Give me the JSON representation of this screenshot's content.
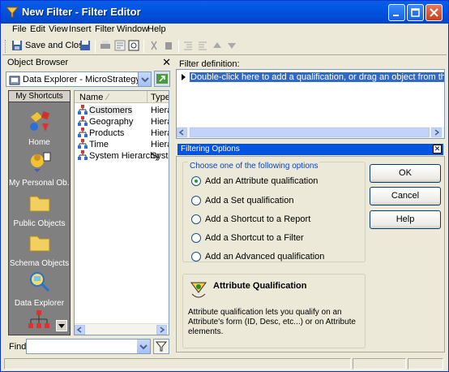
{
  "window": {
    "title": "New Filter - Filter Editor"
  },
  "menu": [
    "File",
    "Edit",
    "View",
    "Insert",
    "Filter",
    "Window",
    "Help"
  ],
  "toolbar": {
    "save_close_label": "Save and Close"
  },
  "object_browser": {
    "title": "Object Browser",
    "project": "Data Explorer - MicroStrategy Tutorial",
    "shortcuts_header": "My Shortcuts",
    "shortcuts": [
      {
        "label": "Home",
        "icon": "home-icon"
      },
      {
        "label": "My Personal Ob...",
        "icon": "personal-objects-icon"
      },
      {
        "label": "Public Objects",
        "icon": "folder-icon"
      },
      {
        "label": "Schema Objects",
        "icon": "folder-icon"
      },
      {
        "label": "Data Explorer",
        "icon": "data-explorer-icon"
      }
    ],
    "columns": {
      "name": "Name",
      "type": "Type"
    },
    "items": [
      {
        "name": "Customers",
        "type": "Hierarchy"
      },
      {
        "name": "Geography",
        "type": "Hierarchy"
      },
      {
        "name": "Products",
        "type": "Hierarchy"
      },
      {
        "name": "Time",
        "type": "Hierarchy"
      },
      {
        "name": "System Hierarchy",
        "type": "System Hierarchy"
      }
    ],
    "find_label": "Find:",
    "find_value": ""
  },
  "filter_definition": {
    "label": "Filter definition:",
    "placeholder_row": "Double-click here to add a qualification, or drag an object from the object browser."
  },
  "filtering_options": {
    "title": "Filtering Options",
    "group_label": "Choose one of the following options",
    "options": [
      {
        "label": "Add an Attribute qualification",
        "selected": true
      },
      {
        "label": "Add a Set qualification",
        "selected": false
      },
      {
        "label": "Add a Shortcut to a Report",
        "selected": false
      },
      {
        "label": "Add a Shortcut to a Filter",
        "selected": false
      },
      {
        "label": "Add an Advanced qualification",
        "selected": false
      }
    ],
    "buttons": {
      "ok": "OK",
      "cancel": "Cancel",
      "help": "Help"
    },
    "description": {
      "title": "Attribute Qualification",
      "text": "Attribute qualification lets you qualify on an Attribute's form (ID, Desc, etc...) or on Attribute elements."
    }
  }
}
